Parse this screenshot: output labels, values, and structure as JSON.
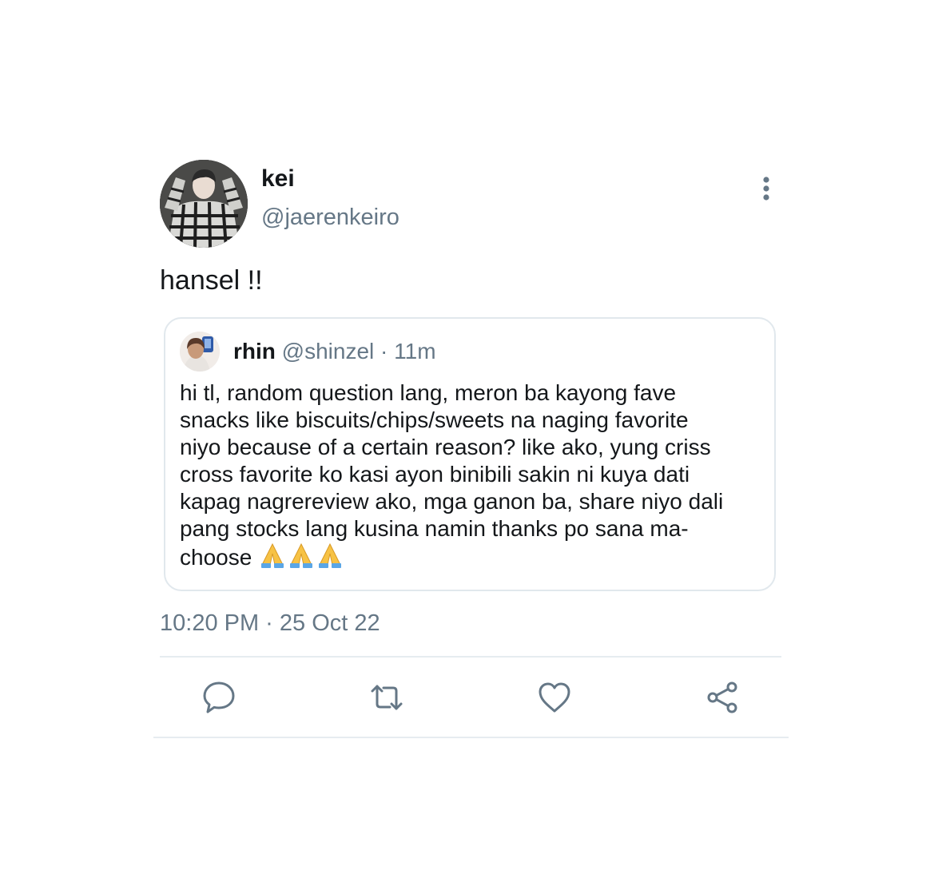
{
  "tweet": {
    "display_name": "kei",
    "handle": "@jaerenkeiro",
    "text": "hansel !!",
    "timestamp": "10:20 PM · 25 Oct 22",
    "more_icon": "more-vertical-icon"
  },
  "quote": {
    "name": "rhin",
    "handle": "@shinzel",
    "separator": "·",
    "time": "11m",
    "text": "hi tl, random question lang, meron ba kayong fave\nsnacks like biscuits/chips/sweets na naging favorite\nniyo because of a certain reason? like ako, yung criss\ncross favorite ko kasi ayon binibili sakin ni kuya dati\nkapag nagrereview ako, mga ganon ba, share niyo dali\npang stocks lang kusina namin thanks po sana ma-\nchoose",
    "emoji_icon": "folded-hands-emoji"
  },
  "actions": [
    {
      "name": "reply",
      "icon": "speech-bubble-icon"
    },
    {
      "name": "retweet",
      "icon": "retweet-arrows-icon"
    },
    {
      "name": "like",
      "icon": "heart-icon"
    },
    {
      "name": "share",
      "icon": "share-nodes-icon"
    }
  ],
  "colors": {
    "text_primary": "#14171a",
    "text_secondary": "#657786",
    "border": "#e1e8ed",
    "icon": "#657786"
  }
}
